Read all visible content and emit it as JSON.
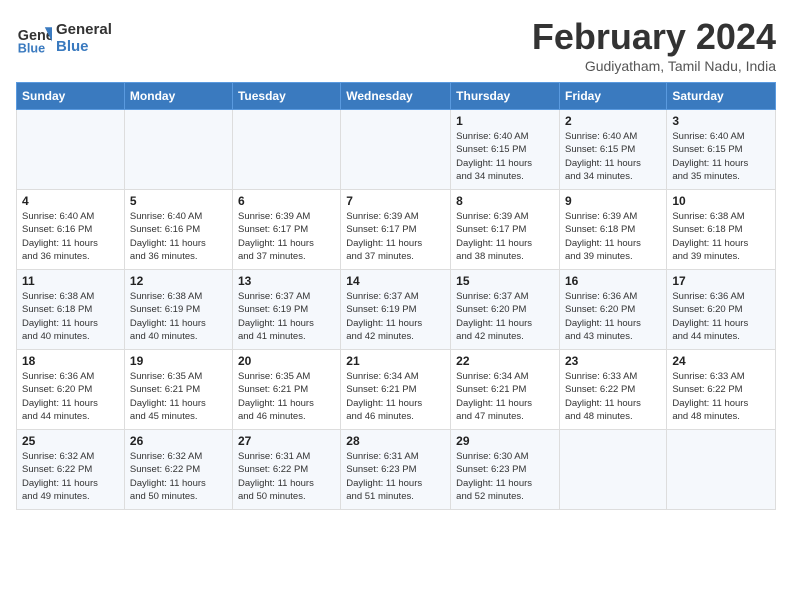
{
  "header": {
    "logo_line1": "General",
    "logo_line2": "Blue",
    "month_title": "February 2024",
    "location": "Gudiyatham, Tamil Nadu, India"
  },
  "weekdays": [
    "Sunday",
    "Monday",
    "Tuesday",
    "Wednesday",
    "Thursday",
    "Friday",
    "Saturday"
  ],
  "weeks": [
    [
      {
        "day": "",
        "info": ""
      },
      {
        "day": "",
        "info": ""
      },
      {
        "day": "",
        "info": ""
      },
      {
        "day": "",
        "info": ""
      },
      {
        "day": "1",
        "info": "Sunrise: 6:40 AM\nSunset: 6:15 PM\nDaylight: 11 hours\nand 34 minutes."
      },
      {
        "day": "2",
        "info": "Sunrise: 6:40 AM\nSunset: 6:15 PM\nDaylight: 11 hours\nand 34 minutes."
      },
      {
        "day": "3",
        "info": "Sunrise: 6:40 AM\nSunset: 6:15 PM\nDaylight: 11 hours\nand 35 minutes."
      }
    ],
    [
      {
        "day": "4",
        "info": "Sunrise: 6:40 AM\nSunset: 6:16 PM\nDaylight: 11 hours\nand 36 minutes."
      },
      {
        "day": "5",
        "info": "Sunrise: 6:40 AM\nSunset: 6:16 PM\nDaylight: 11 hours\nand 36 minutes."
      },
      {
        "day": "6",
        "info": "Sunrise: 6:39 AM\nSunset: 6:17 PM\nDaylight: 11 hours\nand 37 minutes."
      },
      {
        "day": "7",
        "info": "Sunrise: 6:39 AM\nSunset: 6:17 PM\nDaylight: 11 hours\nand 37 minutes."
      },
      {
        "day": "8",
        "info": "Sunrise: 6:39 AM\nSunset: 6:17 PM\nDaylight: 11 hours\nand 38 minutes."
      },
      {
        "day": "9",
        "info": "Sunrise: 6:39 AM\nSunset: 6:18 PM\nDaylight: 11 hours\nand 39 minutes."
      },
      {
        "day": "10",
        "info": "Sunrise: 6:38 AM\nSunset: 6:18 PM\nDaylight: 11 hours\nand 39 minutes."
      }
    ],
    [
      {
        "day": "11",
        "info": "Sunrise: 6:38 AM\nSunset: 6:18 PM\nDaylight: 11 hours\nand 40 minutes."
      },
      {
        "day": "12",
        "info": "Sunrise: 6:38 AM\nSunset: 6:19 PM\nDaylight: 11 hours\nand 40 minutes."
      },
      {
        "day": "13",
        "info": "Sunrise: 6:37 AM\nSunset: 6:19 PM\nDaylight: 11 hours\nand 41 minutes."
      },
      {
        "day": "14",
        "info": "Sunrise: 6:37 AM\nSunset: 6:19 PM\nDaylight: 11 hours\nand 42 minutes."
      },
      {
        "day": "15",
        "info": "Sunrise: 6:37 AM\nSunset: 6:20 PM\nDaylight: 11 hours\nand 42 minutes."
      },
      {
        "day": "16",
        "info": "Sunrise: 6:36 AM\nSunset: 6:20 PM\nDaylight: 11 hours\nand 43 minutes."
      },
      {
        "day": "17",
        "info": "Sunrise: 6:36 AM\nSunset: 6:20 PM\nDaylight: 11 hours\nand 44 minutes."
      }
    ],
    [
      {
        "day": "18",
        "info": "Sunrise: 6:36 AM\nSunset: 6:20 PM\nDaylight: 11 hours\nand 44 minutes."
      },
      {
        "day": "19",
        "info": "Sunrise: 6:35 AM\nSunset: 6:21 PM\nDaylight: 11 hours\nand 45 minutes."
      },
      {
        "day": "20",
        "info": "Sunrise: 6:35 AM\nSunset: 6:21 PM\nDaylight: 11 hours\nand 46 minutes."
      },
      {
        "day": "21",
        "info": "Sunrise: 6:34 AM\nSunset: 6:21 PM\nDaylight: 11 hours\nand 46 minutes."
      },
      {
        "day": "22",
        "info": "Sunrise: 6:34 AM\nSunset: 6:21 PM\nDaylight: 11 hours\nand 47 minutes."
      },
      {
        "day": "23",
        "info": "Sunrise: 6:33 AM\nSunset: 6:22 PM\nDaylight: 11 hours\nand 48 minutes."
      },
      {
        "day": "24",
        "info": "Sunrise: 6:33 AM\nSunset: 6:22 PM\nDaylight: 11 hours\nand 48 minutes."
      }
    ],
    [
      {
        "day": "25",
        "info": "Sunrise: 6:32 AM\nSunset: 6:22 PM\nDaylight: 11 hours\nand 49 minutes."
      },
      {
        "day": "26",
        "info": "Sunrise: 6:32 AM\nSunset: 6:22 PM\nDaylight: 11 hours\nand 50 minutes."
      },
      {
        "day": "27",
        "info": "Sunrise: 6:31 AM\nSunset: 6:22 PM\nDaylight: 11 hours\nand 50 minutes."
      },
      {
        "day": "28",
        "info": "Sunrise: 6:31 AM\nSunset: 6:23 PM\nDaylight: 11 hours\nand 51 minutes."
      },
      {
        "day": "29",
        "info": "Sunrise: 6:30 AM\nSunset: 6:23 PM\nDaylight: 11 hours\nand 52 minutes."
      },
      {
        "day": "",
        "info": ""
      },
      {
        "day": "",
        "info": ""
      }
    ]
  ]
}
